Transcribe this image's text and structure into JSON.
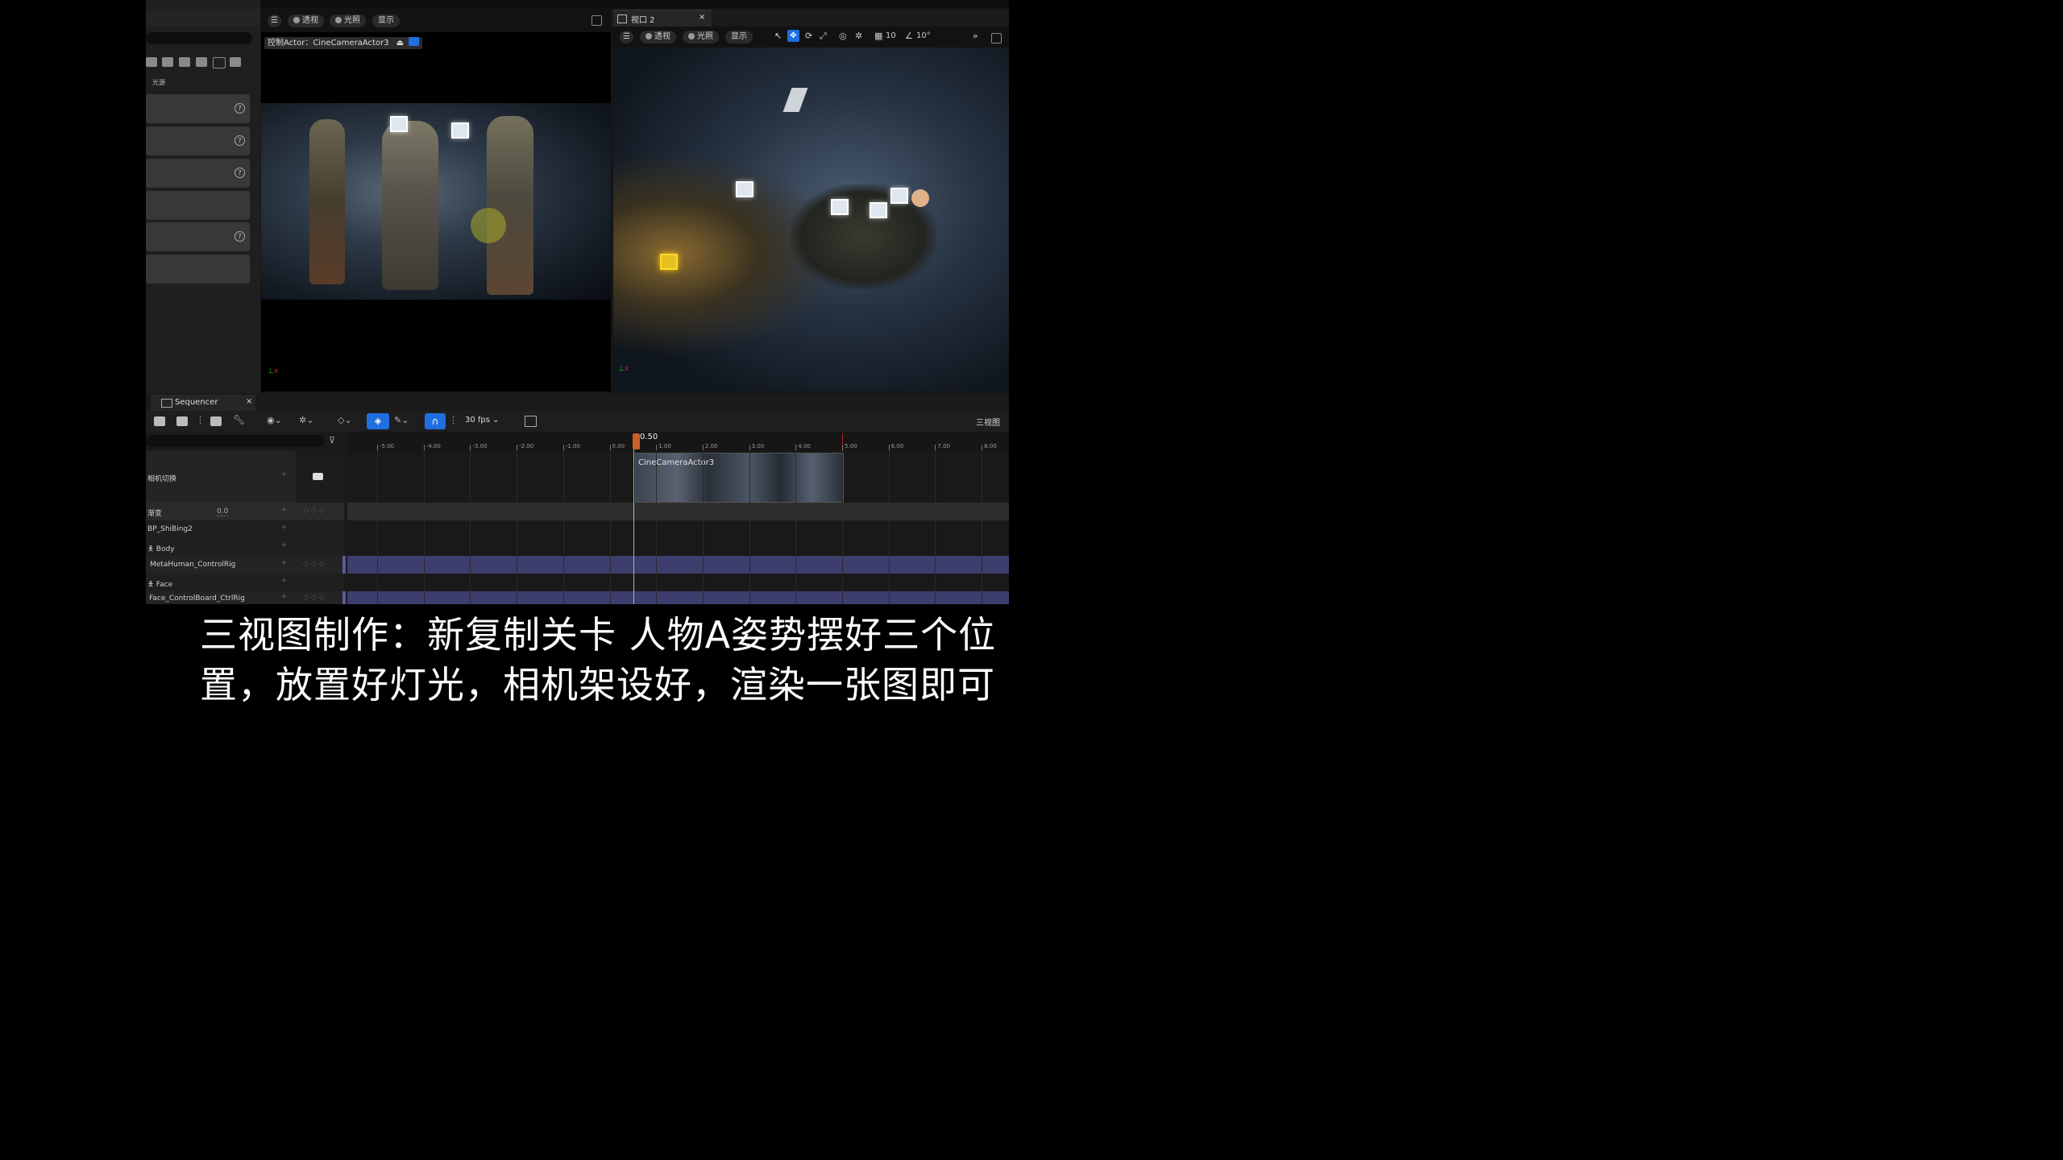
{
  "left_panel": {
    "category_label": "光源"
  },
  "viewport1": {
    "perspective_label": "透视",
    "lighting_label": "光照",
    "show_label": "显示",
    "pilot_label": "控制Actor：CineCameraActor3"
  },
  "viewport2": {
    "tab_title": "视口 2",
    "perspective_label": "透视",
    "lighting_label": "光照",
    "show_label": "显示",
    "grid_snap": "10",
    "rotate_snap": "10°"
  },
  "sequencer": {
    "tab_title": "Sequencer",
    "fps": "30 fps",
    "right_label": "三视图",
    "playhead": "0.50",
    "ruler": [
      "-5.00",
      "-4.00",
      "-3.00",
      "-2.00",
      "-1.00",
      "0.00",
      "1.00",
      "2.00",
      "3.00",
      "4.00",
      "5.00",
      "6.00",
      "7.00",
      "8.00"
    ],
    "tracks": {
      "camera_cut": "相机切换",
      "fade": "渐变",
      "fade_value": "0.0",
      "actor": "BP_ShiBing2",
      "body": "Body",
      "control_rig": "MetaHuman_ControlRig",
      "face": "Face",
      "face_rig": "Face_ControlBoard_CtrlRig"
    },
    "clip_label": "CineCameraActor3"
  },
  "subtitle": {
    "line1": "三视图制作：新复制关卡 人物A姿势摆好三个位",
    "line2": "置，放置好灯光，相机架设好，渲染一张图即可"
  },
  "colors": {
    "accent_blue": "#1f6fe0",
    "playhead_orange": "#c8602a",
    "end_marker_red": "#b02020",
    "rig_track_purple": "#3d3d6e"
  }
}
